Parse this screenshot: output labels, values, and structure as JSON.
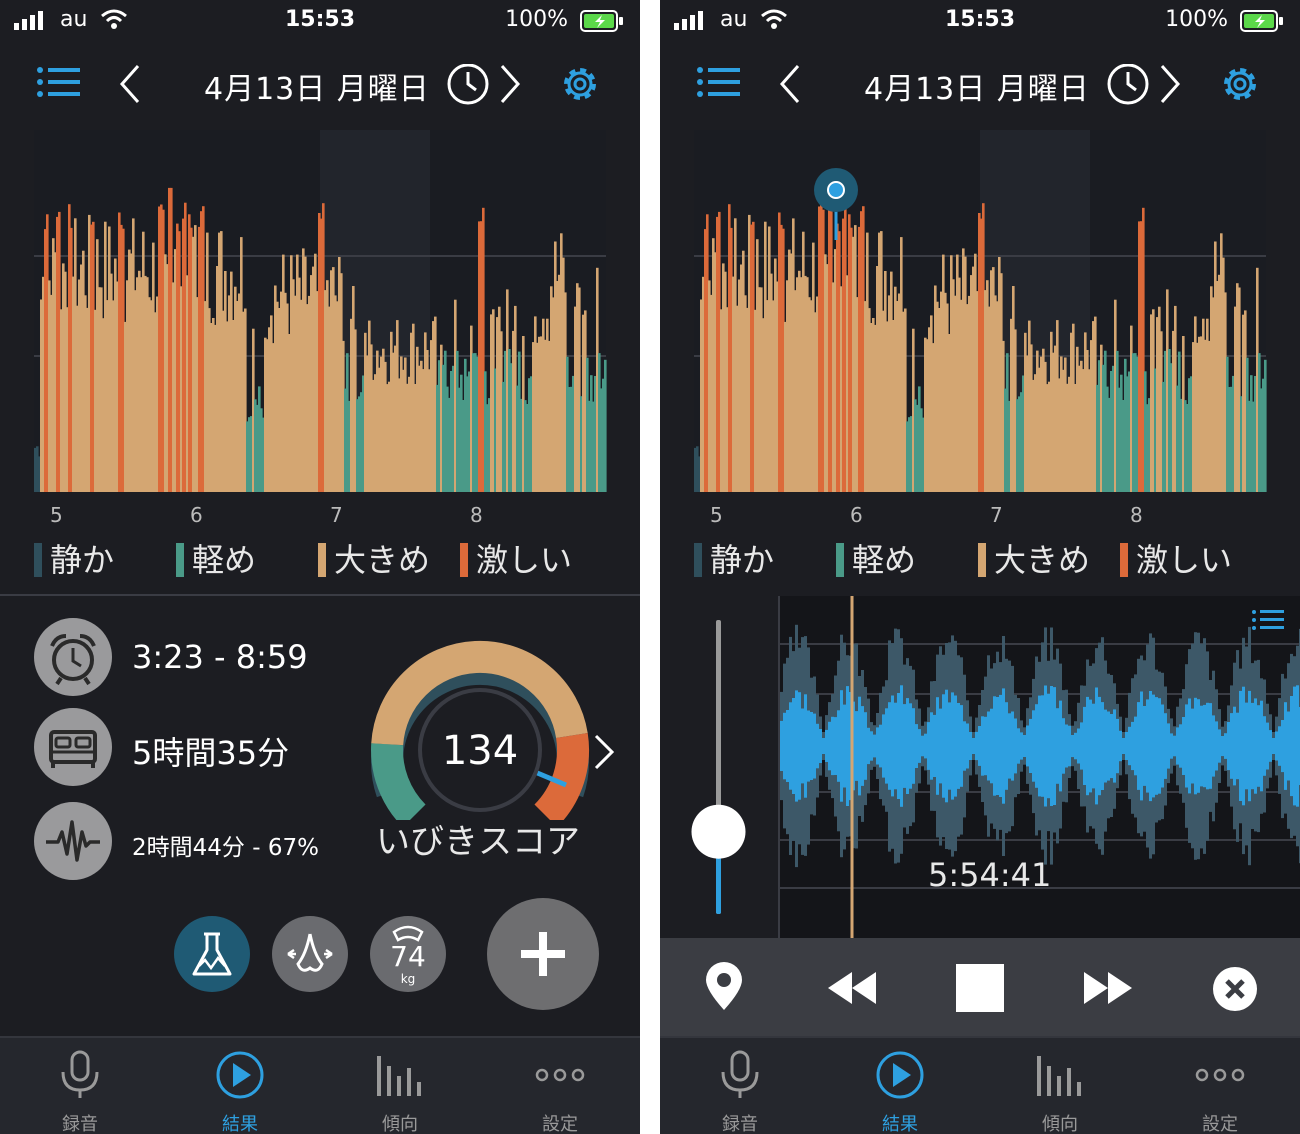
{
  "status": {
    "carrier": "au",
    "time": "15:53",
    "battery": "100%"
  },
  "header": {
    "date": "4月13日 月曜日"
  },
  "chart_data": {
    "type": "area",
    "x": [
      "5",
      "6",
      "7",
      "8"
    ],
    "series": [
      {
        "name": "静か",
        "color": "#2f4f5c"
      },
      {
        "name": "軽め",
        "color": "#4a9a88"
      },
      {
        "name": "大きめ",
        "color": "#d4a672"
      },
      {
        "name": "激しい",
        "color": "#dc6a3a"
      }
    ]
  },
  "legend": {
    "items": [
      "静か",
      "軽め",
      "大きめ",
      "激しい"
    ]
  },
  "summary": {
    "time_range": "3:23 - 8:59",
    "duration": "5時間35分",
    "snore": "2時間44分 - 67%"
  },
  "score": {
    "value": "134",
    "label": "いびきスコア",
    "segments": {
      "quiet": 0.0,
      "light": 0.18,
      "loud": 0.62,
      "epic": 0.2
    }
  },
  "weight": {
    "value": "74",
    "unit": "kg"
  },
  "playback": {
    "timestamp": "5:54:41",
    "volume_fraction": 0.28
  },
  "tabs": [
    {
      "label": "録音",
      "icon": "mic-icon"
    },
    {
      "label": "結果",
      "icon": "play-icon"
    },
    {
      "label": "傾向",
      "icon": "bars-icon"
    },
    {
      "label": "設定",
      "icon": "dots-icon"
    }
  ],
  "colors": {
    "accent": "#2ea0e0",
    "quiet": "#2f4f5c",
    "light": "#4a9a88",
    "loud": "#d4a672",
    "epic": "#dc6a3a"
  }
}
